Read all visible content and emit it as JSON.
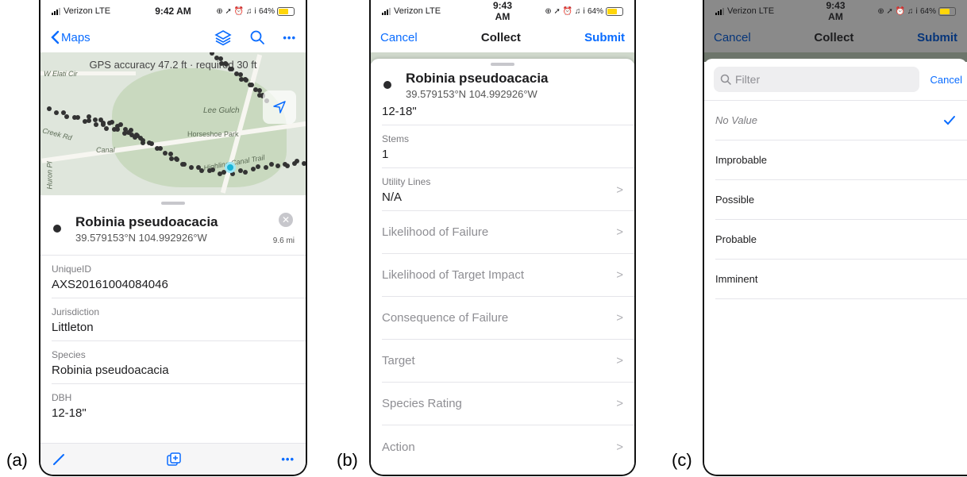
{
  "labels": {
    "a": "(a)",
    "b": "(b)",
    "c": "(c)"
  },
  "status": {
    "carrier": "Verizon LTE",
    "time_a": "9:42 AM",
    "time_b": "9:43 AM",
    "time_c": "9:43 AM",
    "battery": "64%",
    "icons": "⊕ ➚ ⏰ ♫ ⅰ"
  },
  "panel_a": {
    "nav": {
      "back_label": "Maps",
      "more": "•••"
    },
    "map": {
      "gps": "GPS accuracy 47.2 ft · required 30 ft",
      "labels": [
        "W Elati Cir",
        "Lee Gulch",
        "Horseshoe Park",
        "Creek Rd",
        "Canal",
        "Huron Pl",
        "Highline Canal Trail"
      ]
    },
    "feature": {
      "title": "Robinia pseudoacacia",
      "coords": "39.579153°N 104.992926°W",
      "distance": "9.6 mi"
    },
    "fields": [
      {
        "key": "UniqueID",
        "value": "AXS20161004084046"
      },
      {
        "key": "Jurisdiction",
        "value": "Littleton"
      },
      {
        "key": "Species",
        "value": "Robinia pseudoacacia"
      },
      {
        "key": "DBH",
        "value": "12-18\""
      }
    ],
    "toolbar": {
      "more": "•••"
    }
  },
  "panel_b": {
    "nav": {
      "cancel": "Cancel",
      "title": "Collect",
      "submit": "Submit"
    },
    "feature": {
      "title": "Robinia pseudoacacia",
      "coords": "39.579153°N 104.992926°W"
    },
    "partial_value": "12-18\"",
    "fields": [
      {
        "key": "Stems",
        "value": "1"
      },
      {
        "key": "Utility Lines",
        "value": "N/A"
      }
    ],
    "rows": [
      "Likelihood of Failure",
      "Likelihood of Target Impact",
      "Consequence of Failure",
      "Target",
      "Species Rating",
      "Action"
    ]
  },
  "panel_c": {
    "nav": {
      "cancel": "Cancel",
      "title": "Collect",
      "submit": "Submit"
    },
    "filter": {
      "placeholder": "Filter",
      "cancel": "Cancel"
    },
    "options": [
      "No Value",
      "Improbable",
      "Possible",
      "Probable",
      "Imminent"
    ],
    "selected": "No Value"
  },
  "colors": {
    "accent": "#0a6cff",
    "battery": "#ffd60a"
  }
}
